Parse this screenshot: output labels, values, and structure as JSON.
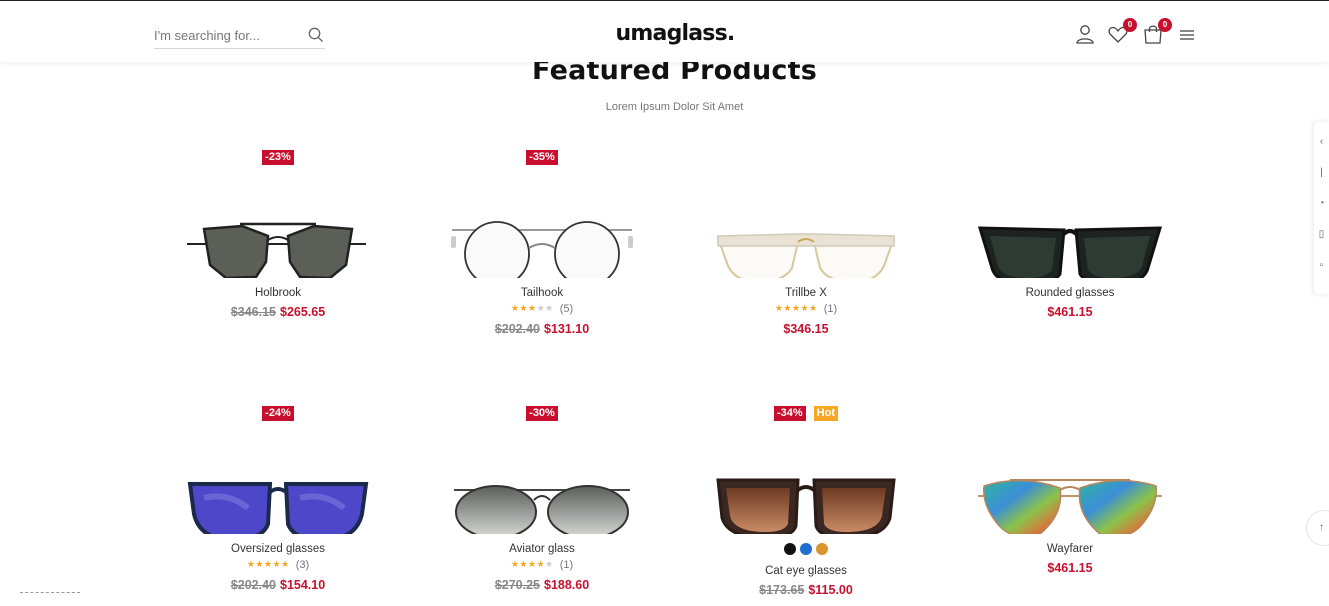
{
  "header": {
    "search_placeholder": "I'm searching for...",
    "logo": "umaglass.",
    "wishlist_count": "0",
    "cart_count": "0"
  },
  "section": {
    "title": "Featured Products",
    "subtitle": "Lorem Ipsum Dolor Sit Amet"
  },
  "products": [
    {
      "name": "Holbrook",
      "badges": [
        "-23%"
      ],
      "old_price": "$346.15",
      "price": "$265.65"
    },
    {
      "name": "Tailhook",
      "badges": [
        "-35%"
      ],
      "rating": 3,
      "reviews": "(5)",
      "old_price": "$202.40",
      "price": "$131.10"
    },
    {
      "name": "Trillbe X",
      "badges": [],
      "rating": 5,
      "reviews": "(1)",
      "price": "$346.15"
    },
    {
      "name": "Rounded glasses",
      "badges": [],
      "price": "$461.15"
    },
    {
      "name": "Oversized glasses",
      "badges": [
        "-24%"
      ],
      "rating": 5,
      "reviews": "(3)",
      "old_price": "$202.40",
      "price": "$154.10"
    },
    {
      "name": "Aviator glass",
      "badges": [
        "-30%"
      ],
      "rating": 4,
      "reviews": "(1)",
      "old_price": "$270.25",
      "price": "$188.60"
    },
    {
      "name": "Cat eye glasses",
      "badges": [
        "-34%",
        "Hot"
      ],
      "swatches": [
        "#111111",
        "#1e6fd0",
        "#d9962b"
      ],
      "old_price": "$173.65",
      "price": "$115.00"
    },
    {
      "name": "Wayfarer",
      "badges": [],
      "price": "$461.15"
    }
  ],
  "colors": {
    "sale": "#c8102e",
    "hot": "#f5a623",
    "star": "#f5a623"
  },
  "icons": [
    "search-icon",
    "user-icon",
    "heart-icon",
    "cart-icon",
    "menu-icon",
    "arrow-up-icon"
  ]
}
